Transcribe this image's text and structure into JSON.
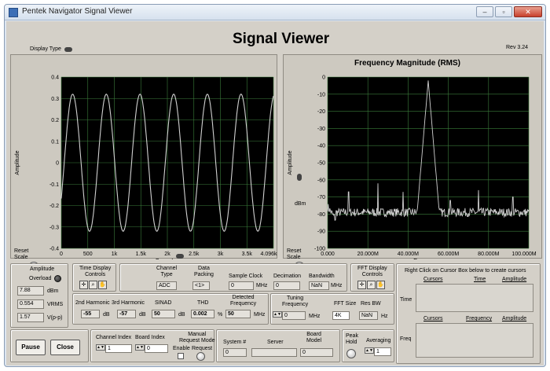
{
  "window": {
    "title": "Pentek Navigator Signal Viewer",
    "buttons": [
      "‒",
      "▫",
      "✕"
    ]
  },
  "header": {
    "title": "Signal Viewer",
    "version": "Rev 3.24",
    "display_type_label": "Display Type"
  },
  "time_graph": {
    "y_axis_label": "Amplitude",
    "x_axis_label": "Samples",
    "reset_scale": "Reset\nScale"
  },
  "freq_graph": {
    "title": "Frequency Magnitude (RMS)",
    "y_axis_label": "Amplitude",
    "y_unit_label": "dBm",
    "x_axis_label": "Frequency",
    "reset_scale": "Reset\nScale"
  },
  "chart_data": [
    {
      "type": "line",
      "title": "",
      "xlabel": "Samples",
      "ylabel": "Amplitude",
      "xlim": [
        0,
        4096
      ],
      "ylim": [
        -0.4,
        0.4
      ],
      "x_ticks": [
        "0",
        "500",
        "1k",
        "1.5k",
        "2k",
        "2.5k",
        "3k",
        "3.5k",
        "4.096k"
      ],
      "y_ticks": [
        "0.4",
        "0.3",
        "0.2",
        "0.1",
        "0",
        "-0.1",
        "-0.2",
        "-0.3",
        "-0.4"
      ],
      "series": [
        {
          "amplitude": 0.32,
          "cycles": 6.3,
          "color": "#d0d0d0"
        }
      ]
    },
    {
      "type": "line",
      "title": "Frequency Magnitude (RMS)",
      "xlabel": "Frequency",
      "ylabel": "Amplitude",
      "xlim": [
        0,
        100
      ],
      "ylim": [
        -100,
        0
      ],
      "x_ticks": [
        "0.000",
        "20.000M",
        "40.000M",
        "60.000M",
        "80.000M",
        "100.000M"
      ],
      "y_ticks": [
        "0",
        "-10",
        "-20",
        "-30",
        "-40",
        "-50",
        "-60",
        "-70",
        "-80",
        "-90",
        "-100"
      ],
      "series": [
        {
          "noise_floor": -79,
          "peak_freq": 50,
          "peak_level": -2,
          "spurs": [
            [
              10.5,
              -67
            ],
            [
              25,
              -62
            ],
            [
              37.5,
              -67
            ],
            [
              61,
              -72
            ],
            [
              75,
              -66
            ],
            [
              92,
              -70
            ]
          ],
          "color": "#d0d0d0"
        }
      ]
    }
  ],
  "amplitude": {
    "title": "Amplitude",
    "overload": "Overload",
    "dbm_value": "7.88",
    "dbm_unit": "dBm",
    "vrms_value": "0.554",
    "vrms_unit": "VRMS",
    "vpp_value": "1.57",
    "vpp_unit": "V(p-p)"
  },
  "time_controls": {
    "title": "Time Display\nControls"
  },
  "fft_controls": {
    "title": "FFT Display\nControls"
  },
  "channel": {
    "type_label": "Channel\nType",
    "type_value": "ADC",
    "packing_label": "Data\nPacking",
    "packing_value": "<1>",
    "clock_label": "Sample Clock",
    "clock_value": "0",
    "clock_unit": "MHz",
    "decimation_label": "Decimation",
    "decimation_value": "0",
    "bandwidth_label": "Bandwidth",
    "bandwidth_value": "NaN",
    "bandwidth_unit": "MHz"
  },
  "measure": {
    "h2_label": "2nd Harmonic",
    "h2_value": "-55",
    "h2_unit": "dB",
    "h3_label": "3rd Harmonic",
    "h3_value": "-57",
    "h3_unit": "dB",
    "sinad_label": "SINAD",
    "sinad_value": "50",
    "sinad_unit": "dB",
    "thd_label": "THD",
    "thd_value": "0.002",
    "thd_unit": "%",
    "detfreq_label": "Detected\nFrequency",
    "detfreq_value": "50",
    "detfreq_unit": "MHz",
    "tuning_label": "Tuning\nFrequency",
    "tuning_value": "0",
    "tuning_unit": "MHz",
    "fftsize_label": "FFT Size",
    "fftsize_value": "4K",
    "resbw_label": "Res BW",
    "resbw_value": "NaN",
    "resbw_unit": "Hz"
  },
  "cursors": {
    "hint": "Right Click on Cursor Box below to create cursors",
    "time_label": "Time",
    "time_cols": [
      "Cursors",
      "Time",
      "Amplitude"
    ],
    "freq_label": "Freq",
    "freq_cols": [
      "Cursors",
      "Frequency",
      "Amplitude"
    ]
  },
  "bottom": {
    "pause": "Pause",
    "close": "Close",
    "channel_index_label": "Channel Index",
    "channel_index_value": "1",
    "board_index_label": "Board Index",
    "board_index_value": "0",
    "manual_label": "Manual\nRequest Mode",
    "enable_label": "Enable",
    "request_label": "Request",
    "system_label": "System #",
    "system_value": "0",
    "server_label": "Server",
    "server_value": "",
    "board_model_label": "Board\nModel",
    "board_model_value": "0",
    "peak_hold_label": "Peak\nHold",
    "averaging_label": "Averaging",
    "averaging_value": "1"
  },
  "colors": {
    "panel": "#d4d0c8",
    "plot_bg": "#000000",
    "grid": "#3b7d3b",
    "trace": "#d0d0d0"
  }
}
